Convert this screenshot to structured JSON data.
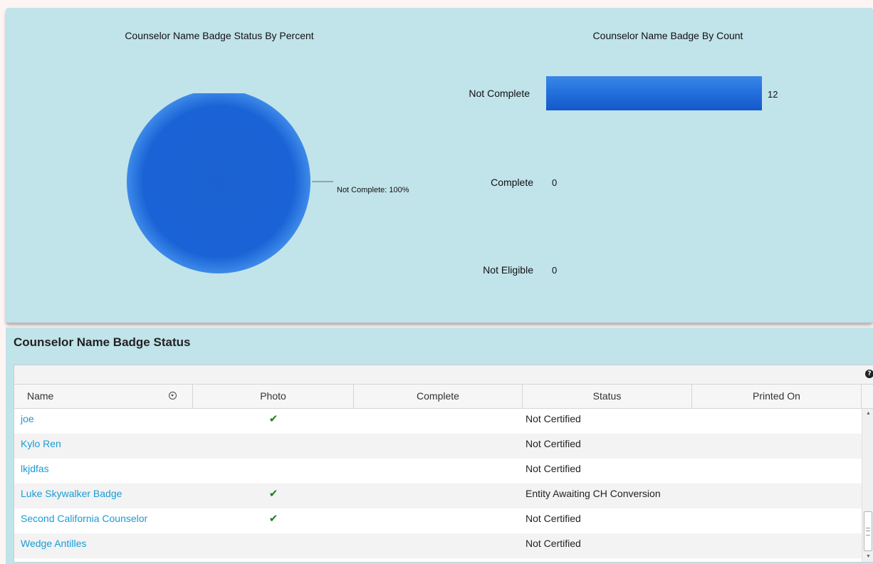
{
  "charts": {
    "pie": {
      "title": "Counselor Name Badge Status By Percent",
      "slice_label": "Not Complete: 100%"
    },
    "bar": {
      "title": "Counselor Name Badge By Count",
      "categories": [
        "Not Complete",
        "Complete",
        "Not Eligible"
      ],
      "values": [
        "12",
        "0",
        "0"
      ]
    }
  },
  "chart_data": [
    {
      "type": "pie",
      "title": "Counselor Name Badge Status By Percent",
      "labels": [
        "Not Complete"
      ],
      "values": [
        100
      ],
      "color": "#1f6bd8"
    },
    {
      "type": "bar",
      "orientation": "horizontal",
      "title": "Counselor Name Badge By Count",
      "categories": [
        "Not Complete",
        "Complete",
        "Not Eligible"
      ],
      "values": [
        12,
        0,
        0
      ],
      "xlim": [
        0,
        12
      ],
      "color": "#1f6bd8"
    }
  ],
  "section": {
    "title": "Counselor Name Badge Status"
  },
  "grid": {
    "help_icon": "question-icon",
    "columns": {
      "name": "Name",
      "photo": "Photo",
      "complete": "Complete",
      "status": "Status",
      "printed_on": "Printed On"
    },
    "check_glyph": "✔",
    "rows": [
      {
        "name": "joe",
        "photo": true,
        "status": "Not Certified"
      },
      {
        "name": "Kylo Ren",
        "photo": false,
        "status": "Not Certified"
      },
      {
        "name": "lkjdfas",
        "photo": false,
        "status": "Not Certified"
      },
      {
        "name": "Luke Skywalker Badge",
        "photo": true,
        "status": "Entity Awaiting CH Conversion"
      },
      {
        "name": "Second California Counselor",
        "photo": true,
        "status": "Not Certified"
      },
      {
        "name": "Wedge Antilles",
        "photo": false,
        "status": "Not Certified"
      }
    ]
  },
  "colors": {
    "panel_bg": "#c1e3ea",
    "bar_blue": "#1f6bd8",
    "link": "#1a9bd4",
    "check": "#1e7d1e"
  }
}
